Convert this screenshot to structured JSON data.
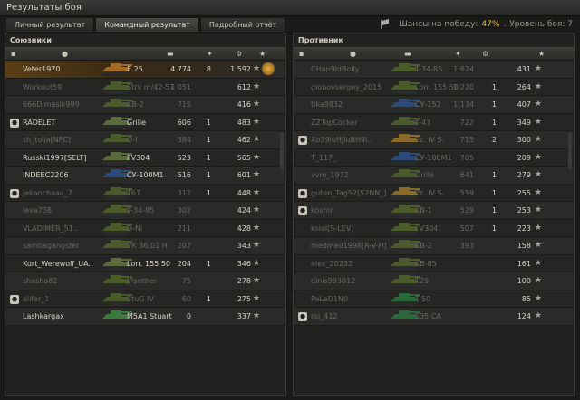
{
  "window": {
    "title": "Результаты боя"
  },
  "tabs": [
    "Личный результат",
    "Командный результат",
    "Подробный отчёт"
  ],
  "header": {
    "chance_prefix": "Шансы на победу:",
    "chance_value": "47%",
    "level": "Уровень боя: 7"
  },
  "allies": {
    "title": "Союзники",
    "rows": [
      {
        "name": "Veter1970",
        "tank": "E 25",
        "dmg": "4 774",
        "kills": "8",
        "xp": "1 592",
        "me": true,
        "dead": false,
        "platoon": false,
        "tank_color": "#a06a28"
      },
      {
        "name": "Workout59",
        "tank": "Strv m/42-57",
        "dmg": "1 051",
        "kills": "",
        "xp": "612",
        "dead": true,
        "platoon": false,
        "tank_color": "#4a5a2a"
      },
      {
        "name": "666Dimasik999",
        "tank": "KB-2",
        "dmg": "715",
        "kills": "",
        "xp": "416",
        "dead": true,
        "platoon": false,
        "tank_color": "#4a5a2a"
      },
      {
        "name": "RADELET",
        "tank": "Grille",
        "dmg": "606",
        "kills": "1",
        "xp": "483",
        "dead": false,
        "platoon": true,
        "tank_color": "#5a6a3a"
      },
      {
        "name": "sh_tolja[NFC]",
        "tank": "O-I",
        "dmg": "584",
        "kills": "1",
        "xp": "462",
        "dead": true,
        "platoon": false,
        "tank_color": "#4a5a2a"
      },
      {
        "name": "Russki1997[SELT]",
        "tank": "FV304",
        "dmg": "523",
        "kills": "1",
        "xp": "565",
        "dead": false,
        "platoon": false,
        "tank_color": "#5a6a3a"
      },
      {
        "name": "INDEEC2206",
        "tank": "СУ-100М1",
        "dmg": "516",
        "kills": "1",
        "xp": "601",
        "dead": false,
        "platoon": false,
        "tank_color": "#2a4a7a"
      },
      {
        "name": "jekanchaaa_7",
        "tank": "T67",
        "dmg": "312",
        "kills": "1",
        "xp": "448",
        "dead": true,
        "platoon": true,
        "tank_color": "#4a5a2a"
      },
      {
        "name": "leva738",
        "tank": "T-34-85",
        "dmg": "302",
        "kills": "",
        "xp": "424",
        "dead": true,
        "platoon": false,
        "tank_color": "#4a5a2a"
      },
      {
        "name": "VLADIMER_51..",
        "tank": "D-Ni",
        "dmg": "211",
        "kills": "",
        "xp": "428",
        "dead": true,
        "platoon": false,
        "tank_color": "#4a5a2a"
      },
      {
        "name": "sambagangster",
        "tank": "VK 36.01 H",
        "dmg": "207",
        "kills": "",
        "xp": "343",
        "dead": true,
        "platoon": false,
        "tank_color": "#4a5a2a"
      },
      {
        "name": "Kurt_Werewolf_UA..",
        "tank": "Lorr. 155 50",
        "dmg": "204",
        "kills": "1",
        "xp": "346",
        "dead": false,
        "platoon": false,
        "tank_color": "#5a6a3a"
      },
      {
        "name": "shasha82",
        "tank": "JPanther",
        "dmg": "75",
        "kills": "",
        "xp": "278",
        "dead": true,
        "platoon": false,
        "tank_color": "#4a5a2a"
      },
      {
        "name": "alifer_1",
        "tank": "StuG IV",
        "dmg": "60",
        "kills": "1",
        "xp": "275",
        "dead": true,
        "platoon": true,
        "tank_color": "#4a5a2a"
      },
      {
        "name": "Lashkargax",
        "tank": "M5A1 Stuart",
        "dmg": "0",
        "kills": "",
        "xp": "337",
        "dead": false,
        "platoon": false,
        "tank_color": "#3a7a3a"
      }
    ]
  },
  "enemies": {
    "title": "Противник",
    "rows": [
      {
        "name": "CHap9ldBolly",
        "tank": "T-34-85",
        "dmg": "1 624",
        "kills": "",
        "xp": "431",
        "dead": true,
        "platoon": false,
        "tank_color": "#4a5a2a"
      },
      {
        "name": "globovsergey_2015",
        "tank": "Lorr. 155 50",
        "dmg": "1 220",
        "kills": "1",
        "xp": "264",
        "dead": true,
        "platoon": false,
        "tank_color": "#4a5a2a"
      },
      {
        "name": "tika9832",
        "tank": "СУ-152",
        "dmg": "1 134",
        "kills": "1",
        "xp": "407",
        "dead": true,
        "platoon": false,
        "tank_color": "#2a4a7a"
      },
      {
        "name": "ZZTopCocker",
        "tank": "T-43",
        "dmg": "722",
        "kills": "1",
        "xp": "349",
        "dead": true,
        "platoon": false,
        "tank_color": "#4a5a2a"
      },
      {
        "name": "Xo39luHJluBH9l..",
        "tank": "Pz. IV S.",
        "dmg": "715",
        "kills": "2",
        "xp": "300",
        "dead": true,
        "platoon": true,
        "tank_color": "#8a6a28"
      },
      {
        "name": "T_117_",
        "tank": "СУ-100М1",
        "dmg": "705",
        "kills": "",
        "xp": "209",
        "dead": true,
        "platoon": false,
        "tank_color": "#2a4a7a"
      },
      {
        "name": "vvm_1972",
        "tank": "Grille",
        "dmg": "641",
        "kills": "1",
        "xp": "279",
        "dead": true,
        "platoon": false,
        "tank_color": "#4a5a2a"
      },
      {
        "name": "guten_Tag52[52NN_]",
        "tank": "Pz. IV S.",
        "dmg": "559",
        "kills": "1",
        "xp": "255",
        "dead": true,
        "platoon": true,
        "tank_color": "#8a6a28"
      },
      {
        "name": "kosmr",
        "tank": "KB-1",
        "dmg": "529",
        "kills": "1",
        "xp": "253",
        "dead": true,
        "platoon": true,
        "tank_color": "#4a5a2a"
      },
      {
        "name": "ksiol[S-LEV]",
        "tank": "FV304",
        "dmg": "507",
        "kills": "1",
        "xp": "223",
        "dead": true,
        "platoon": false,
        "tank_color": "#4a5a2a"
      },
      {
        "name": "medmed1998[R-V-H]",
        "tank": "KB-2",
        "dmg": "393",
        "kills": "",
        "xp": "158",
        "dead": true,
        "platoon": false,
        "tank_color": "#4a5a2a"
      },
      {
        "name": "alex_20232",
        "tank": "KB-85",
        "dmg": "",
        "kills": "",
        "xp": "161",
        "dead": true,
        "platoon": false,
        "tank_color": "#4a5a2a"
      },
      {
        "name": "dinis993012",
        "tank": "T29",
        "dmg": "",
        "kills": "",
        "xp": "100",
        "dead": true,
        "platoon": false,
        "tank_color": "#4a5a2a"
      },
      {
        "name": "PaLaD1N0",
        "tank": "T-50",
        "dmg": "",
        "kills": "",
        "xp": "85",
        "dead": true,
        "platoon": false,
        "tank_color": "#2a6a3a"
      },
      {
        "name": "roi_412",
        "tank": "S35 CA",
        "dmg": "",
        "kills": "",
        "xp": "124",
        "dead": true,
        "platoon": true,
        "tank_color": "#2a6a3a"
      }
    ]
  }
}
